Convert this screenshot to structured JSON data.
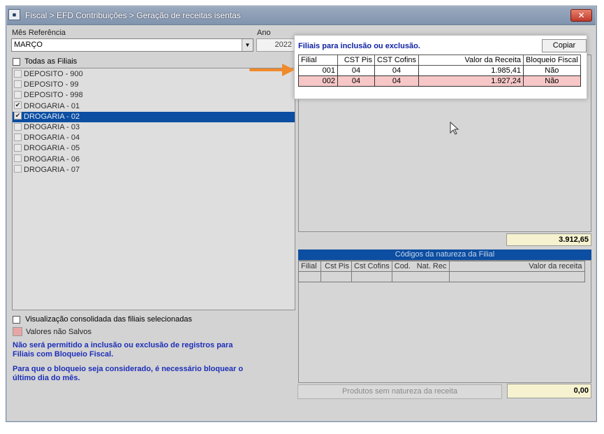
{
  "window": {
    "title": "Fiscal > EFD Contribuições > Geração de receitas isentas",
    "icon": "app-icon",
    "close_glyph": "✕"
  },
  "filters": {
    "month_label": "Mês Referência",
    "month_value": "MARÇO",
    "year_label": "Ano",
    "year_value": "2022",
    "all_branches_label": "Todas as Filiais"
  },
  "branches": [
    {
      "label": "DEPOSITO - 900",
      "checked": false,
      "selected": false
    },
    {
      "label": "DEPOSITO - 99",
      "checked": false,
      "selected": false
    },
    {
      "label": "DEPOSITO - 998",
      "checked": false,
      "selected": false
    },
    {
      "label": "DROGARIA - 01",
      "checked": true,
      "selected": false
    },
    {
      "label": "DROGARIA - 02",
      "checked": true,
      "selected": true
    },
    {
      "label": "DROGARIA - 03",
      "checked": false,
      "selected": false
    },
    {
      "label": "DROGARIA - 04",
      "checked": false,
      "selected": false
    },
    {
      "label": "DROGARIA - 05",
      "checked": false,
      "selected": false
    },
    {
      "label": "DROGARIA - 06",
      "checked": false,
      "selected": false
    },
    {
      "label": "DROGARIA - 07",
      "checked": false,
      "selected": false
    }
  ],
  "options": {
    "consolidated_label": "Visualização consolidada das filiais selecionadas",
    "unsaved_label": "Valores não Salvos",
    "unsaved_color": "#e8a5a5"
  },
  "info": {
    "line1": "Não será permitido a inclusão ou exclusão de registros para",
    "line2": "Filiais com Bloqueio Fiscal.",
    "line3": "Para que o bloqueio seja considerado, é necessário bloquear o",
    "line4": "último dia do mês."
  },
  "filiais": {
    "heading": "Filiais para inclusão ou exclusão.",
    "copy_label": "Copiar",
    "columns": [
      "Filial",
      "CST Pis",
      "CST Cofins",
      "Valor da Receita",
      "Bloqueio Fiscal"
    ],
    "rows": [
      {
        "filial": "001",
        "cst_pis": "04",
        "cst_cofins": "04",
        "valor": "1.985,41",
        "bloqueio": "Não",
        "unsaved": false
      },
      {
        "filial": "002",
        "cst_pis": "04",
        "cst_cofins": "04",
        "valor": "1.927,24",
        "bloqueio": "Não",
        "unsaved": true
      }
    ],
    "total": "3.912,65"
  },
  "natureza": {
    "title": "Códigos da natureza da Filial",
    "columns": [
      "Filial",
      "Cst Pis",
      "Cst Cofins",
      "Cod.",
      "Nat. Rec",
      "Valor da receita"
    ]
  },
  "footer": {
    "produtos_label": "Produtos sem natureza da receita",
    "total": "0,00"
  },
  "colors": {
    "selection": "#0b4ea2",
    "info_text": "#1d2fb8",
    "total_bg": "#f6f2cf",
    "arrow": "#f08a2a"
  }
}
